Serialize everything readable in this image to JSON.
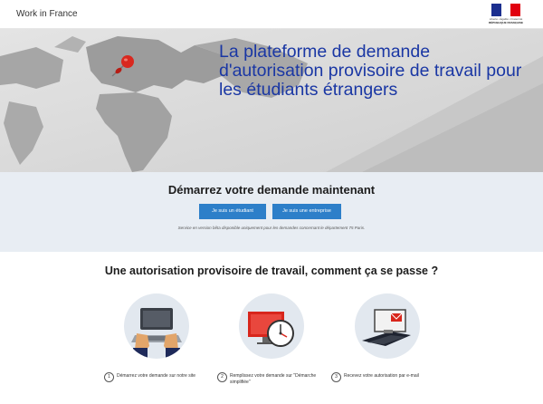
{
  "header": {
    "brand": "Work in France",
    "logo_motto": "Liberté • Égalité • Fraternité",
    "logo_label": "RÉPUBLIQUE FRANÇAISE"
  },
  "hero": {
    "title": "La plateforme de demande d'autorisation provisoire de travail pour les étudiants étrangers",
    "title_color": "#1a37a4",
    "pin_color": "#d9281f"
  },
  "cta": {
    "title": "Démarrez votre demande maintenant",
    "student_button": "Je suis un étudiant",
    "company_button": "Je suis une entreprise",
    "notice": "Service en version bêta disponible uniquement pour les demandes concernant le département 75 Paris.",
    "button_color": "#2d7fc9"
  },
  "how": {
    "title": "Une autorisation provisoire de travail, comment ça se passe ?",
    "steps": [
      {
        "number": "1",
        "text": "Démarrez votre demande sur notre site",
        "icon": "laptop-icon"
      },
      {
        "number": "2",
        "text": "Remplissez votre demande sur \"Démarche simplifiée\"",
        "icon": "clock-monitor-icon"
      },
      {
        "number": "3",
        "text": "Recevez votre autorisation par e-mail",
        "icon": "mail-icon"
      }
    ]
  }
}
